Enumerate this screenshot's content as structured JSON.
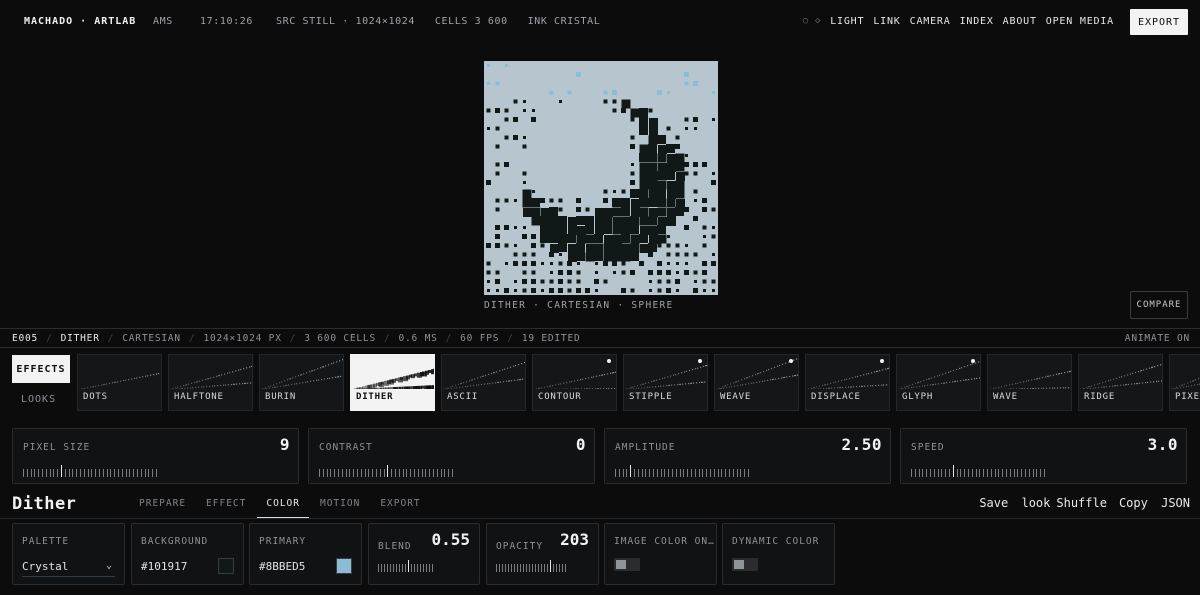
{
  "topbar": {
    "brand": "MACHADO · ARTLAB",
    "location": "AMS",
    "clock": "17:10:26",
    "source_info": "SRC STILL · 1024×1024   CELLS 3 600   INK CRISTAL",
    "nav": [
      "LIGHT",
      "LINK",
      "CAMERA",
      "INDEX",
      "ABOUT",
      "OPEN MEDIA"
    ],
    "export_label": "EXPORT",
    "dots": [
      "○",
      "◇"
    ]
  },
  "preview": {
    "caption": "DITHER · CARTESIAN · SPHERE",
    "compare_label": "COMPARE",
    "background_color": "#B7C6CE",
    "ink_color": "#101917",
    "accent_color": "#8BBED5"
  },
  "status": {
    "items": [
      "E005",
      "DITHER",
      "CARTESIAN",
      "1024×1024 PX",
      "3 600 CELLS",
      "0.6 MS",
      "60 FPS",
      "19 EDITED"
    ],
    "animate": "ANIMATE ON"
  },
  "modes": {
    "effects": "EFFECTS",
    "looks": "LOOKS"
  },
  "effects": [
    {
      "label": "DOTS",
      "badge": false
    },
    {
      "label": "HALFTONE",
      "badge": false
    },
    {
      "label": "BURIN",
      "badge": false
    },
    {
      "label": "DITHER",
      "badge": false,
      "active": true
    },
    {
      "label": "ASCII",
      "badge": false
    },
    {
      "label": "CONTOUR",
      "badge": true
    },
    {
      "label": "STIPPLE",
      "badge": true
    },
    {
      "label": "WEAVE",
      "badge": true
    },
    {
      "label": "DISPLACE",
      "badge": true
    },
    {
      "label": "GLYPH",
      "badge": true
    },
    {
      "label": "WAVE",
      "badge": false
    },
    {
      "label": "RIDGE",
      "badge": false
    },
    {
      "label": "PIXEL",
      "badge": false
    }
  ],
  "params": [
    {
      "label": "PIXEL SIZE",
      "value": "9",
      "level": 0.28
    },
    {
      "label": "CONTRAST",
      "value": "0",
      "level": 0.5
    },
    {
      "label": "AMPLITUDE",
      "value": "2.50",
      "level": 0.12
    },
    {
      "label": "SPEED",
      "value": "3.0",
      "level": 0.3
    }
  ],
  "section": {
    "title": "Dither",
    "tabs": [
      "PREPARE",
      "EFFECT",
      "COLOR",
      "MOTION",
      "EXPORT"
    ],
    "active_tab": "COLOR",
    "actions": [
      "Save",
      "look",
      "Shuffle",
      "Copy",
      "JSON"
    ]
  },
  "color": {
    "palette_label": "PALETTE",
    "palette_value": "Crystal",
    "background_label": "BACKGROUND",
    "background_value": "#101917",
    "primary_label": "PRIMARY",
    "primary_value": "#8BBED5",
    "blend_label": "BLEND",
    "blend_value": "0.55",
    "blend_level": 0.55,
    "opacity_label": "OPACITY",
    "opacity_value": "203",
    "opacity_level": 0.8,
    "image_color_label": "IMAGE COLOR ON…",
    "dynamic_color_label": "DYNAMIC COLOR"
  }
}
